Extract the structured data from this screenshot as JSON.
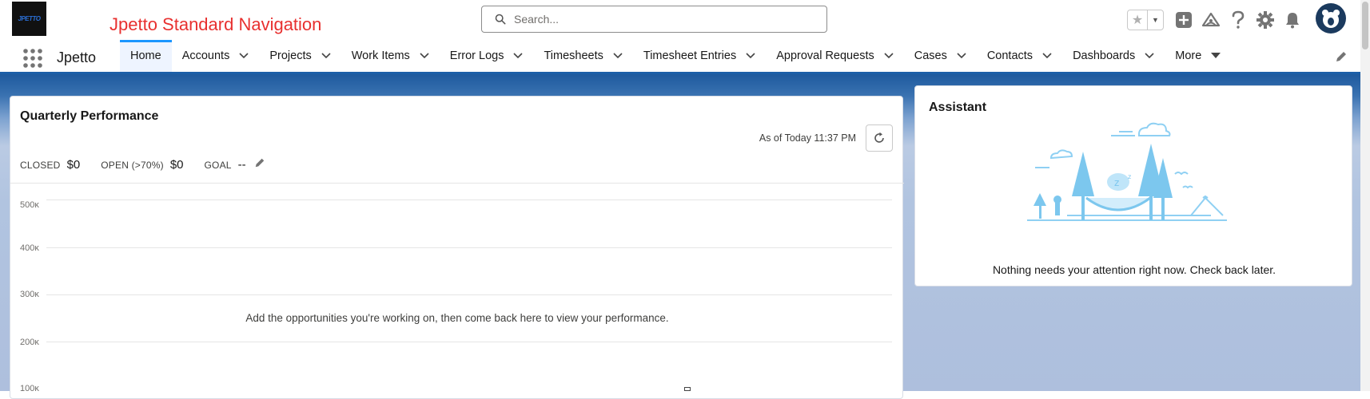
{
  "header": {
    "logo_text": "JPETTO",
    "title": "Jpetto Standard Navigation",
    "search_placeholder": "Search..."
  },
  "nav": {
    "app_name": "Jpetto",
    "items": [
      {
        "label": "Home",
        "active": true
      },
      {
        "label": "Accounts"
      },
      {
        "label": "Projects"
      },
      {
        "label": "Work Items"
      },
      {
        "label": "Error Logs"
      },
      {
        "label": "Timesheets"
      },
      {
        "label": "Timesheet Entries"
      },
      {
        "label": "Approval Requests"
      },
      {
        "label": "Cases"
      },
      {
        "label": "Contacts"
      },
      {
        "label": "Dashboards"
      },
      {
        "label": "More"
      }
    ]
  },
  "performance": {
    "title": "Quarterly Performance",
    "as_of": "As of Today 11:37 PM",
    "closed_label": "CLOSED",
    "closed_value": "$0",
    "open_label": "OPEN (>70%)",
    "open_value": "$0",
    "goal_label": "GOAL",
    "goal_value": "--",
    "y_ticks": [
      "500ĸ",
      "400ĸ",
      "300ĸ",
      "200ĸ",
      "100ĸ"
    ],
    "empty_message": "Add the opportunities you're working on, then come back here to view your performance."
  },
  "assistant": {
    "title": "Assistant",
    "message": "Nothing needs your attention right now. Check back later."
  },
  "colors": {
    "brand_red": "#e8302f",
    "nav_accent": "#1b96ff",
    "hero_blue": "#1e5a9e"
  }
}
